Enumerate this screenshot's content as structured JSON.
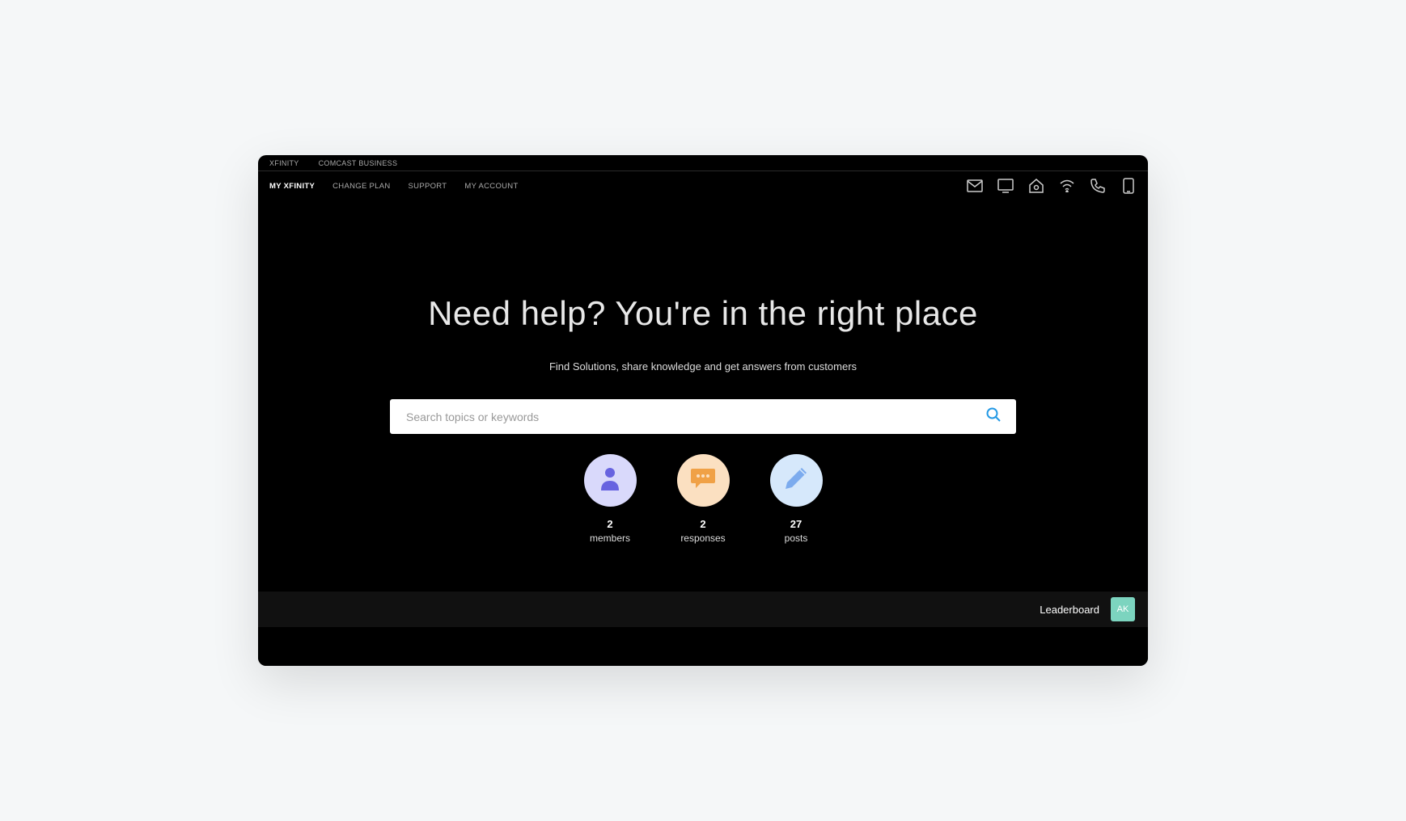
{
  "topBar": {
    "links": [
      "XFINITY",
      "COMCAST BUSINESS"
    ]
  },
  "navBar": {
    "items": [
      {
        "label": "MY XFINITY",
        "active": true
      },
      {
        "label": "CHANGE PLAN",
        "active": false
      },
      {
        "label": "SUPPORT",
        "active": false
      },
      {
        "label": "MY ACCOUNT",
        "active": false
      }
    ],
    "icons": [
      "mail-icon",
      "tv-icon",
      "home-icon",
      "wifi-icon",
      "phone-icon",
      "mobile-icon"
    ]
  },
  "hero": {
    "title": "Need help? You're in the right place",
    "subtitle": "Find Solutions, share knowledge and get answers from customers"
  },
  "search": {
    "placeholder": "Search topics or keywords"
  },
  "stats": {
    "members": {
      "count": "2",
      "label": "members"
    },
    "responses": {
      "count": "2",
      "label": "responses"
    },
    "posts": {
      "count": "27",
      "label": "posts"
    }
  },
  "bottomBar": {
    "leaderboard": "Leaderboard",
    "avatarInitials": "AK"
  },
  "colors": {
    "accentBlue": "#2399e5",
    "memberIcon": "#6763e0",
    "responseIcon": "#f0a146",
    "postIcon": "#7cabee",
    "avatarBadge": "#7cd4bf"
  }
}
